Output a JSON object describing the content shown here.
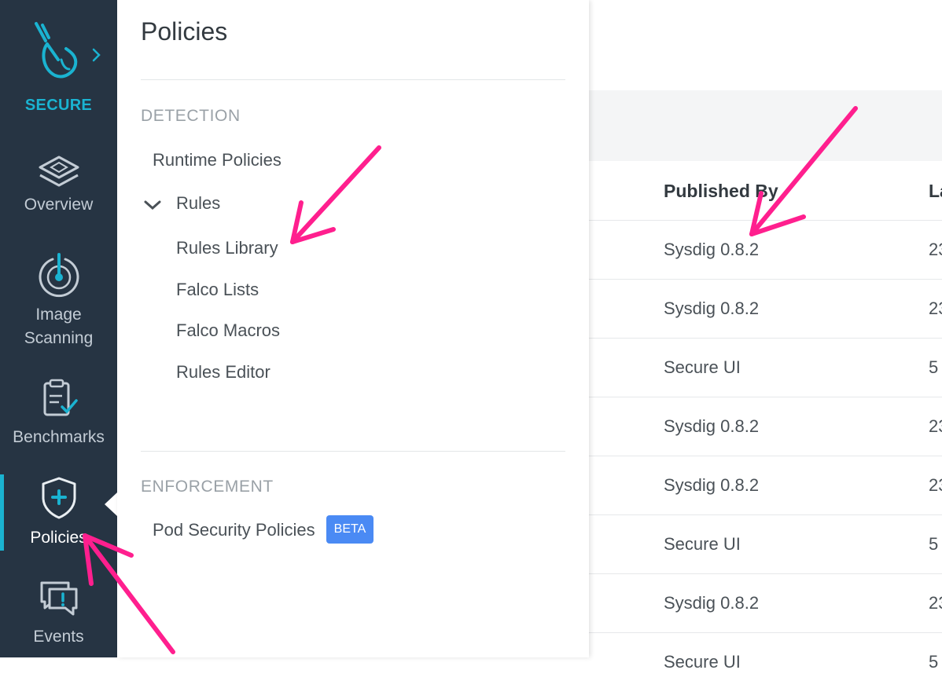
{
  "app": {
    "brand_label": "SECURE"
  },
  "rail": {
    "items": [
      {
        "label": "Overview",
        "icon": "layers-icon"
      },
      {
        "label": "Image",
        "label2": "Scanning",
        "icon": "scan-target-icon"
      },
      {
        "label": "Benchmarks",
        "icon": "clipboard-check-icon"
      },
      {
        "label": "Policies",
        "icon": "shield-plus-icon",
        "active": true
      },
      {
        "label": "Events",
        "icon": "chat-alert-icon"
      }
    ]
  },
  "flyout": {
    "title": "Policies",
    "detection": {
      "heading": "DETECTION",
      "runtime_policies": "Runtime Policies",
      "rules": "Rules",
      "rules_children": [
        "Rules Library",
        "Falco Lists",
        "Falco Macros",
        "Rules Editor"
      ]
    },
    "enforcement": {
      "heading": "ENFORCEMENT",
      "pod_security_policies": "Pod Security Policies",
      "badge": "BETA"
    }
  },
  "table": {
    "columns": [
      "Published By",
      "La"
    ],
    "rows": [
      {
        "published_by": "Sysdig 0.8.2",
        "last": "23"
      },
      {
        "published_by": "Sysdig 0.8.2",
        "last": "23"
      },
      {
        "published_by": "Secure UI",
        "last": "5"
      },
      {
        "published_by": "Sysdig 0.8.2",
        "last": "23"
      },
      {
        "published_by": "Sysdig 0.8.2",
        "last": "23"
      },
      {
        "published_by": "Secure UI",
        "last": "5"
      },
      {
        "published_by": "Sysdig 0.8.2",
        "last": "23"
      },
      {
        "published_by": "Secure UI",
        "last": "5"
      }
    ]
  },
  "colors": {
    "rail_bg": "#263443",
    "accent": "#1ab3d1",
    "badge": "#4a8af4",
    "annotation": "#ff1f8e"
  }
}
